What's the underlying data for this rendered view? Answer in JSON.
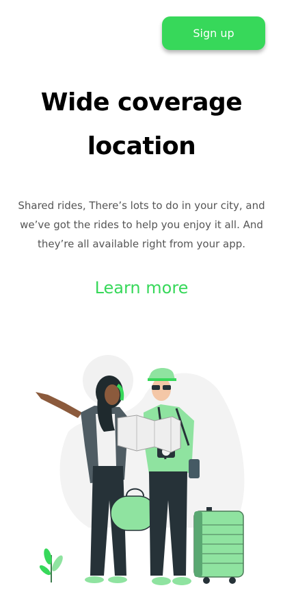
{
  "header": {
    "signup_label": "Sign up"
  },
  "hero": {
    "title_line1": "Wide coverage",
    "title_line2": "location",
    "description": "Shared rides, There’s lots to do in your city, and we’ve got the rides to help you enjoy it all. And they’re all available right from your app.",
    "learn_more_label": "Learn more"
  },
  "colors": {
    "accent": "#37d85a",
    "text_primary": "#000000",
    "text_secondary": "#555555"
  }
}
